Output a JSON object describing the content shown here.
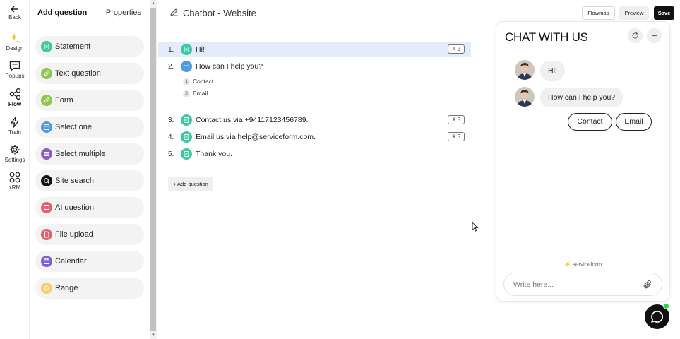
{
  "rail": {
    "back": "Back",
    "items": [
      {
        "label": "Design",
        "icon": "sparkle-icon"
      },
      {
        "label": "Popups",
        "icon": "message-square-icon"
      },
      {
        "label": "Flow",
        "icon": "share-nodes-icon",
        "active": true
      },
      {
        "label": "Train",
        "icon": "lightning-icon"
      },
      {
        "label": "Settings",
        "icon": "gear-icon"
      },
      {
        "label": "xRM",
        "icon": "grid-circles-icon"
      }
    ]
  },
  "palette": {
    "tab_add": "Add question",
    "tab_properties": "Properties",
    "items": [
      {
        "label": "Statement",
        "color": "#3ec7a3"
      },
      {
        "label": "Text question",
        "color": "#8cc64b"
      },
      {
        "label": "Form",
        "color": "#8cc64b"
      },
      {
        "label": "Select one",
        "color": "#4b9be0"
      },
      {
        "label": "Select multiple",
        "color": "#8c5cc4"
      },
      {
        "label": "Site search",
        "color": "#111111"
      },
      {
        "label": "AI question",
        "color": "#e0606e"
      },
      {
        "label": "File upload",
        "color": "#e0606e"
      },
      {
        "label": "Calendar",
        "color": "#7a5ed6"
      },
      {
        "label": "Range",
        "color": "#f2cf6b"
      }
    ]
  },
  "topbar": {
    "title": "Chatbot - Website",
    "flowmap": "Flowmap",
    "preview": "Preview",
    "save": "Save"
  },
  "flow": {
    "questions": [
      {
        "num": "1.",
        "text": "Hi!",
        "badge": "2",
        "color": "#3ec7a3"
      },
      {
        "num": "2.",
        "text": "How can I help you?",
        "badge": "",
        "color": "#4b9be0"
      },
      {
        "num": "3.",
        "text": "Contact us via +94117123456789.",
        "badge": "5",
        "color": "#3ec7a3"
      },
      {
        "num": "4.",
        "text": "Email us via help@serviceform.com.",
        "badge": "5",
        "color": "#3ec7a3"
      },
      {
        "num": "5.",
        "text": "Thank you.",
        "badge": "",
        "color": "#3ec7a3"
      }
    ],
    "options": [
      {
        "num": "1",
        "text": "Contact"
      },
      {
        "num": "2",
        "text": "Email"
      }
    ],
    "add_question": "+ Add question"
  },
  "chat": {
    "title": "CHAT WITH US",
    "messages": [
      "Hi!",
      "How can I help you?"
    ],
    "choices": [
      "Contact",
      "Email"
    ],
    "powered_by": "serviceform",
    "input_placeholder": "Write here...",
    "launcher_status_color": "#2bd44a"
  }
}
